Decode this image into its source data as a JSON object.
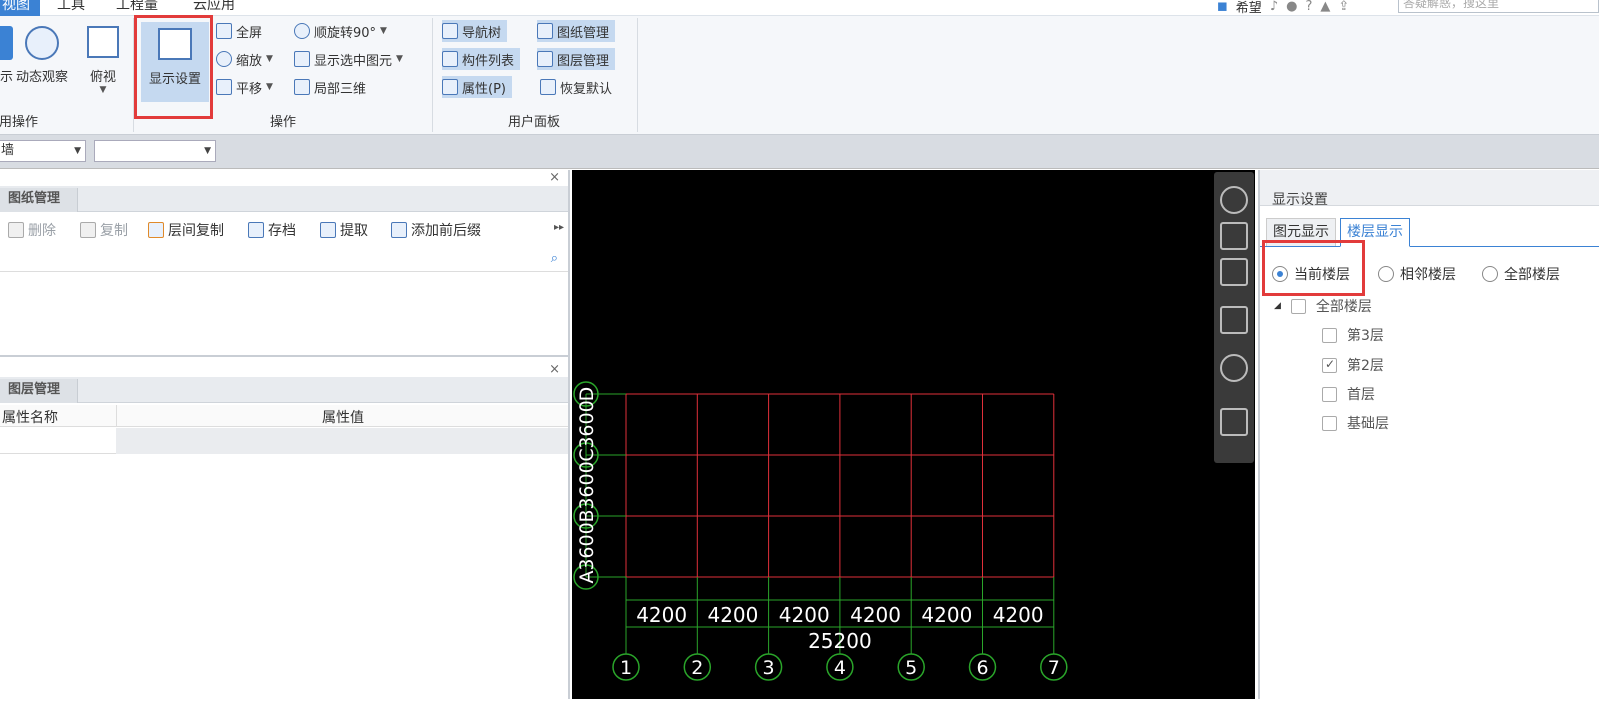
{
  "menu": {
    "tabs": [
      "视图",
      "工具",
      "工程量",
      "云应用"
    ],
    "user": "希望",
    "search_placeholder": "答疑解惑，搜这里"
  },
  "ribbon": {
    "group1": {
      "label": "用操作",
      "buttons": [
        "示",
        "动态观察",
        "俯视"
      ]
    },
    "group2": {
      "label": "操作",
      "big_button": "显示设置",
      "buttons": [
        "全屏",
        "缩放",
        "平移",
        "顺旋转90°",
        "显示选中图元",
        "局部三维"
      ]
    },
    "group3": {
      "label": "用户面板",
      "buttons": [
        "导航树",
        "构件列表",
        "属性(P)",
        "图纸管理",
        "图层管理",
        "恢复默认"
      ]
    }
  },
  "selector": {
    "first": "墙",
    "second": ""
  },
  "drawing_panel": {
    "title": "图纸管理",
    "toolbar": [
      "删除",
      "复制",
      "层间复制",
      "存档",
      "提取",
      "添加前后缀"
    ]
  },
  "layer_panel": {
    "title": "图层管理",
    "col_name": "属性名称",
    "col_value": "属性值"
  },
  "grid": {
    "x_labels": [
      "1",
      "2",
      "3",
      "4",
      "5",
      "6",
      "7"
    ],
    "x_dims": [
      "4200",
      "4200",
      "4200",
      "4200",
      "4200",
      "4200"
    ],
    "x_total": "25200",
    "y_labels": [
      "A",
      "B",
      "C",
      "D"
    ],
    "y_dims": [
      "3600",
      "3600",
      "3600"
    ],
    "colors": {
      "grid": "#e0303a",
      "axis": "#2aa52a",
      "text": "#ffffff"
    }
  },
  "display_settings": {
    "title": "显示设置",
    "tabs": [
      "图元显示",
      "楼层显示"
    ],
    "radios": [
      "当前楼层",
      "相邻楼层",
      "全部楼层"
    ],
    "tree_root": "全部楼层",
    "floors": [
      {
        "label": "第3层",
        "checked": false
      },
      {
        "label": "第2层",
        "checked": true
      },
      {
        "label": "首层",
        "checked": false
      },
      {
        "label": "基础层",
        "checked": false
      }
    ]
  },
  "colors": {
    "accent": "#3b82d4",
    "highlight_red": "#e23b3b"
  }
}
